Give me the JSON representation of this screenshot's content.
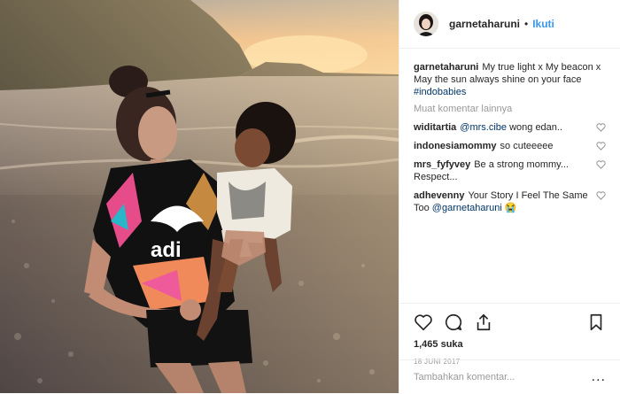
{
  "post": {
    "username": "garnetaharuni",
    "separator": "•",
    "follow_label": "Ikuti",
    "caption": {
      "username": "garnetaharuni",
      "text": "My true light x My beacon x May the sun always shine on your face",
      "hashtag": "#indobabies"
    },
    "load_more": "Muat komentar lainnya",
    "comments": [
      {
        "username": "widitartia",
        "mention": "@mrs.cibe",
        "text": " wong edan.."
      },
      {
        "username": "indonesiamommy",
        "mention": "",
        "text": "so cuteeeee"
      },
      {
        "username": "mrs_fyfyvey",
        "mention": "",
        "text": "Be a strong mommy... Respect..."
      },
      {
        "username": "adhevenny",
        "mention": "@garnetaharuni",
        "text": "Your Story I Feel The Same Too ",
        "emoji": "😭"
      }
    ],
    "likes": "1,465 suka",
    "date": "18 JUNI 2017",
    "comment_placeholder": "Tambahkan komentar...",
    "options_icon": "...",
    "icons": [
      "heart-icon",
      "comment-icon",
      "share-icon",
      "bookmark-icon"
    ]
  }
}
